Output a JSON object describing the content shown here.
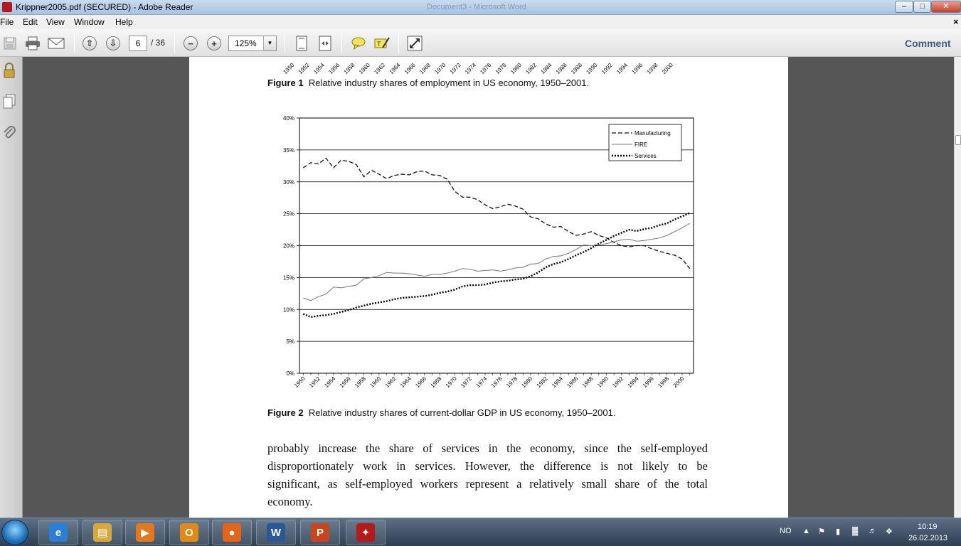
{
  "window": {
    "title": "Krippner2005.pdf (SECURED) - Adobe Reader",
    "background_title": "Document3 - Microsoft Word",
    "controls": {
      "minimize": "–",
      "maximize": "□",
      "close": "✕"
    }
  },
  "menu": {
    "items": [
      "File",
      "Edit",
      "View",
      "Window",
      "Help"
    ],
    "close_doc": "×"
  },
  "toolbar": {
    "page_current": "6",
    "page_total": "/ 36",
    "zoom": "125%",
    "comment_label": "Comment",
    "icons": [
      "save-icon",
      "print-icon",
      "email-icon",
      "prev-page-icon",
      "next-page-icon",
      "zoom-out-icon",
      "zoom-in-icon",
      "fit-page-icon",
      "fit-width-icon",
      "comment-bubble-icon",
      "highlight-icon",
      "expand-icon"
    ]
  },
  "left_panel": {
    "icons": [
      "lock-icon",
      "pages-icon",
      "attachment-icon"
    ]
  },
  "document": {
    "figure1_caption_label": "Figure 1",
    "figure1_caption_text": "Relative industry shares of employment in US economy, 1950–2001.",
    "figure2_caption_label": "Figure 2",
    "figure2_caption_text": "Relative industry shares of current-dollar GDP in US economy, 1950–2001.",
    "body_lines": [
      "probably increase the share of services in the economy, since the self-employed",
      "disproportionately work in services. However, the difference is not likely to be",
      "significant, as self-employed workers represent a relatively small share of the total",
      "economy."
    ]
  },
  "chart_data": {
    "type": "line",
    "title": "",
    "xlabel": "",
    "ylabel": "",
    "x": [
      1950,
      1951,
      1952,
      1953,
      1954,
      1955,
      1956,
      1957,
      1958,
      1959,
      1960,
      1961,
      1962,
      1963,
      1964,
      1965,
      1966,
      1967,
      1968,
      1969,
      1970,
      1971,
      1972,
      1973,
      1974,
      1975,
      1976,
      1977,
      1978,
      1979,
      1980,
      1981,
      1982,
      1983,
      1984,
      1985,
      1986,
      1987,
      1988,
      1989,
      1990,
      1991,
      1992,
      1993,
      1994,
      1995,
      1996,
      1997,
      1998,
      1999,
      2000,
      2001
    ],
    "x_tick_labels": [
      "1950",
      "1952",
      "1954",
      "1956",
      "1958",
      "1960",
      "1962",
      "1964",
      "1966",
      "1968",
      "1970",
      "1972",
      "1974",
      "1976",
      "1978",
      "1980",
      "1982",
      "1984",
      "1986",
      "1988",
      "1990",
      "1992",
      "1994",
      "1996",
      "1998",
      "2000"
    ],
    "y_tick_labels": [
      "0%",
      "5%",
      "10%",
      "15%",
      "20%",
      "25%",
      "30%",
      "35%",
      "40%"
    ],
    "ylim": [
      0,
      40
    ],
    "grid": "horizontal",
    "legend_position": "top-right",
    "series": [
      {
        "name": "Manufacturing",
        "style": "dashed",
        "values": [
          32.2,
          33.0,
          32.8,
          33.7,
          32.2,
          33.4,
          33.2,
          32.7,
          30.8,
          31.8,
          31.2,
          30.5,
          31.0,
          31.2,
          31.1,
          31.6,
          31.7,
          31.1,
          31.0,
          30.4,
          28.5,
          27.6,
          27.6,
          27.2,
          26.4,
          25.8,
          26.1,
          26.5,
          26.2,
          25.7,
          24.5,
          24.2,
          23.4,
          22.9,
          23.0,
          22.2,
          21.6,
          21.8,
          22.2,
          21.6,
          21.2,
          20.5,
          20.0,
          19.8,
          20.0,
          20.0,
          19.5,
          19.1,
          18.8,
          18.5,
          17.9,
          16.4
        ]
      },
      {
        "name": "FIRE",
        "style": "solid-thin",
        "values": [
          11.8,
          11.4,
          12.0,
          12.4,
          13.5,
          13.4,
          13.6,
          13.8,
          14.8,
          15.0,
          15.3,
          15.8,
          15.7,
          15.7,
          15.6,
          15.4,
          15.2,
          15.5,
          15.5,
          15.7,
          16.0,
          16.4,
          16.3,
          16.0,
          16.1,
          16.2,
          16.0,
          16.2,
          16.5,
          16.6,
          17.1,
          17.2,
          17.9,
          18.3,
          18.4,
          18.8,
          19.4,
          20.1,
          20.0,
          20.1,
          20.3,
          20.6,
          20.9,
          21.0,
          20.7,
          20.8,
          21.0,
          21.2,
          21.6,
          22.2,
          22.8,
          23.5
        ]
      },
      {
        "name": "Services",
        "style": "dotted",
        "values": [
          9.3,
          8.8,
          9.0,
          9.1,
          9.3,
          9.6,
          9.9,
          10.3,
          10.6,
          10.9,
          11.1,
          11.3,
          11.6,
          11.8,
          11.9,
          12.0,
          12.1,
          12.3,
          12.6,
          12.8,
          13.1,
          13.6,
          13.8,
          13.8,
          13.9,
          14.2,
          14.4,
          14.5,
          14.7,
          14.8,
          15.2,
          15.8,
          16.6,
          17.1,
          17.4,
          17.9,
          18.5,
          19.0,
          19.6,
          20.3,
          20.9,
          21.5,
          22.0,
          22.5,
          22.3,
          22.6,
          22.8,
          23.2,
          23.5,
          24.1,
          24.6,
          25.1
        ]
      }
    ]
  },
  "taskbar": {
    "apps": [
      {
        "name": "internet-explorer",
        "glyph": "e",
        "color": "#2a7fd4"
      },
      {
        "name": "file-explorer",
        "glyph": "▤",
        "color": "#d9a83a"
      },
      {
        "name": "media-player",
        "glyph": "▶",
        "color": "#e07a1f"
      },
      {
        "name": "outlook",
        "glyph": "O",
        "color": "#e08a17"
      },
      {
        "name": "firefox",
        "glyph": "●",
        "color": "#e2661a"
      },
      {
        "name": "word",
        "glyph": "W",
        "color": "#2b5797"
      },
      {
        "name": "powerpoint",
        "glyph": "P",
        "color": "#c8461f"
      },
      {
        "name": "adobe-reader",
        "glyph": "✦",
        "color": "#b31b1b"
      }
    ],
    "language": "NO",
    "time": "10:19",
    "date": "26.02.2013"
  }
}
